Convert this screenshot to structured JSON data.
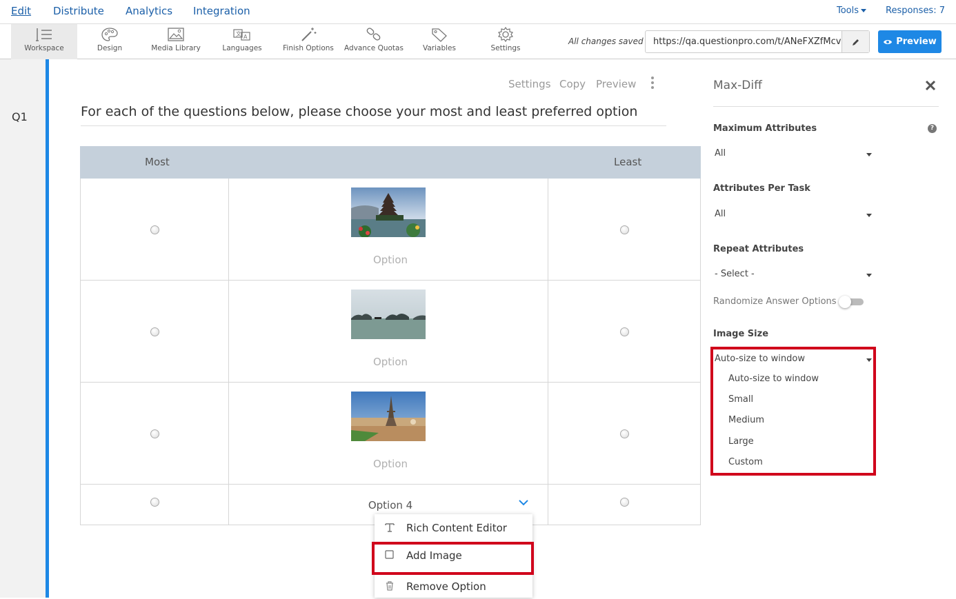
{
  "nav": {
    "items": [
      "Edit",
      "Distribute",
      "Analytics",
      "Integration"
    ],
    "tools": "Tools",
    "responses": "Responses: 7"
  },
  "toolbar": {
    "items": [
      {
        "label": "Workspace",
        "icon": "workspace-icon"
      },
      {
        "label": "Design",
        "icon": "palette-icon"
      },
      {
        "label": "Media Library",
        "icon": "image-icon"
      },
      {
        "label": "Languages",
        "icon": "translate-icon"
      },
      {
        "label": "Finish Options",
        "icon": "magic-wand-icon"
      },
      {
        "label": "Advance Quotas",
        "icon": "link-icon"
      },
      {
        "label": "Variables",
        "icon": "tag-icon"
      },
      {
        "label": "Settings",
        "icon": "gear-icon"
      }
    ],
    "saved_status": "All changes saved",
    "url": "https://qa.questionpro.com/t/ANeFXZfMcv",
    "preview_label": "Preview"
  },
  "question": {
    "number": "Q1",
    "actions": [
      "Settings",
      "Copy",
      "Preview"
    ],
    "text": "For each of the questions below, please choose your most and least preferred option",
    "col_most": "Most",
    "col_least": "Least",
    "rows": [
      {
        "label": "Option",
        "image": "temple-on-lake"
      },
      {
        "label": "Option",
        "image": "bay-with-islands"
      },
      {
        "label": "Option",
        "image": "eiffel-tower-city"
      },
      {
        "label": "Option 4",
        "image": ""
      }
    ]
  },
  "context_menu": {
    "items": [
      {
        "label": "Rich Content Editor",
        "icon": "text-format-icon"
      },
      {
        "label": "Add Image",
        "icon": "image-square-icon"
      },
      {
        "label": "Remove Option",
        "icon": "trash-icon"
      }
    ]
  },
  "panel": {
    "title": "Max-Diff",
    "max_attr_label": "Maximum Attributes",
    "max_attr_value": "All",
    "per_task_label": "Attributes Per Task",
    "per_task_value": "All",
    "repeat_label": "Repeat Attributes",
    "repeat_value": "- Select -",
    "randomize_label": "Randomize Answer Options",
    "randomize_on": false,
    "image_size_label": "Image Size",
    "image_size_value": "Auto-size to window",
    "image_size_options": [
      "Auto-size to window",
      "Small",
      "Medium",
      "Large",
      "Custom"
    ]
  },
  "colors": {
    "accent": "#1e88e5",
    "link": "#1b5fa8",
    "highlight": "#d0021b",
    "table_header": "#c5d0db"
  }
}
